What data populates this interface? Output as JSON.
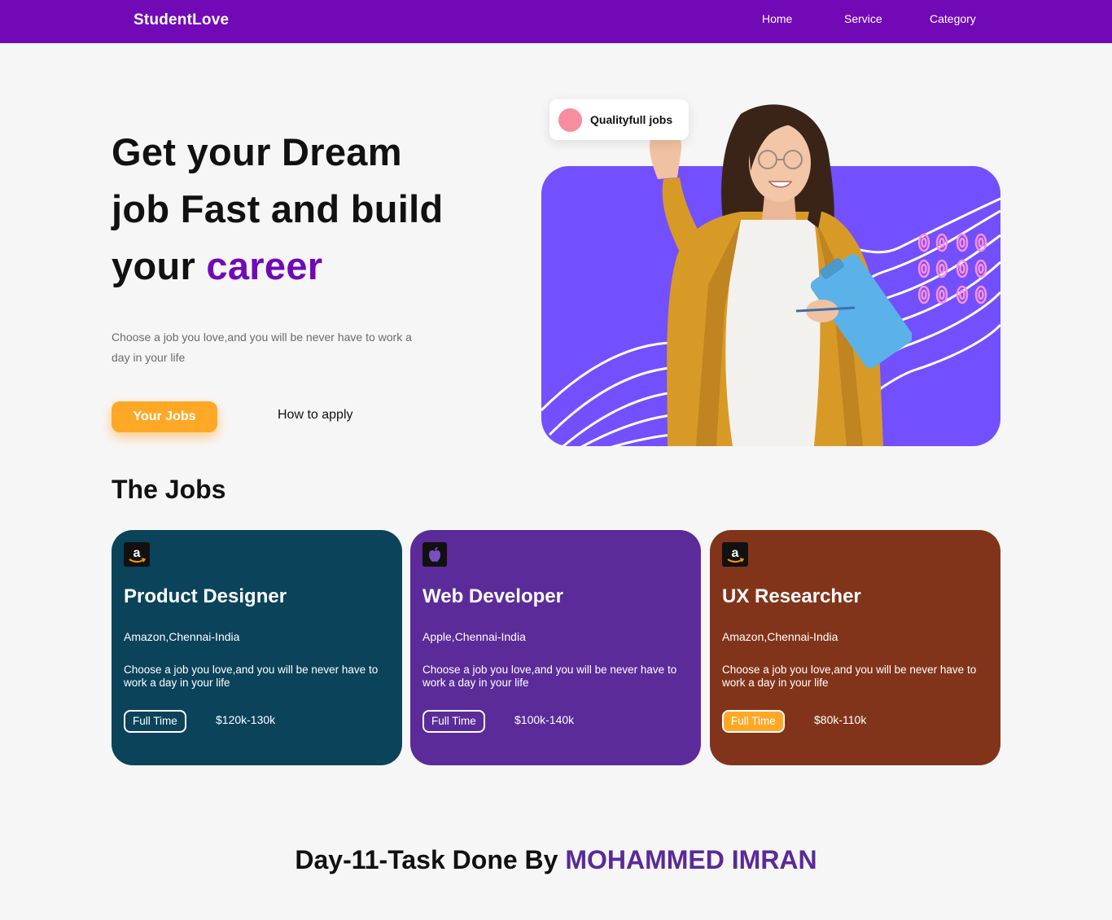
{
  "nav": {
    "brand": "StudentLove",
    "links": [
      "Home",
      "Service",
      "Category"
    ]
  },
  "hero": {
    "title_line1": "Get your Dream",
    "title_line2": "job Fast and build",
    "title_line3_prefix": "your",
    "title_line3_accent": "career",
    "subtitle": "Choose a job you love,and you will be never have to work a day in your life",
    "primary_button": "Your Jobs",
    "secondary_button": "How to apply",
    "badge": "Qualityfull jobs"
  },
  "jobs": {
    "heading": "The Jobs",
    "cards": [
      {
        "logo": "amazon-logo",
        "title": "Product Designer",
        "company": "Amazon,Chennai-India",
        "description": "Choose a job you love,and you will be never have to work a day in your life",
        "type": "Full Time",
        "salary": "$120k-130k",
        "color": "#0b435b"
      },
      {
        "logo": "apple-logo",
        "title": "Web Developer",
        "company": "Apple,Chennai-India",
        "description": "Choose a job you love,and you will be never have to work a day in your life",
        "type": "Full Time",
        "salary": "$100k-140k",
        "color": "#5b2b9a"
      },
      {
        "logo": "amazon-logo",
        "title": "UX Researcher",
        "company": "Amazon,Chennai-India",
        "description": "Choose a job you love,and you will be never have to work a day in your life",
        "type": "Full Time",
        "salary": "$80k-110k",
        "color": "#82341a"
      }
    ]
  },
  "footer": {
    "prefix": "Day-11-Task Done By",
    "author": "MOHAMMED IMRAN"
  },
  "colors": {
    "brand_purple": "#7209b7",
    "hero_card": "#7250ff",
    "accent_orange": "#ffa826"
  }
}
